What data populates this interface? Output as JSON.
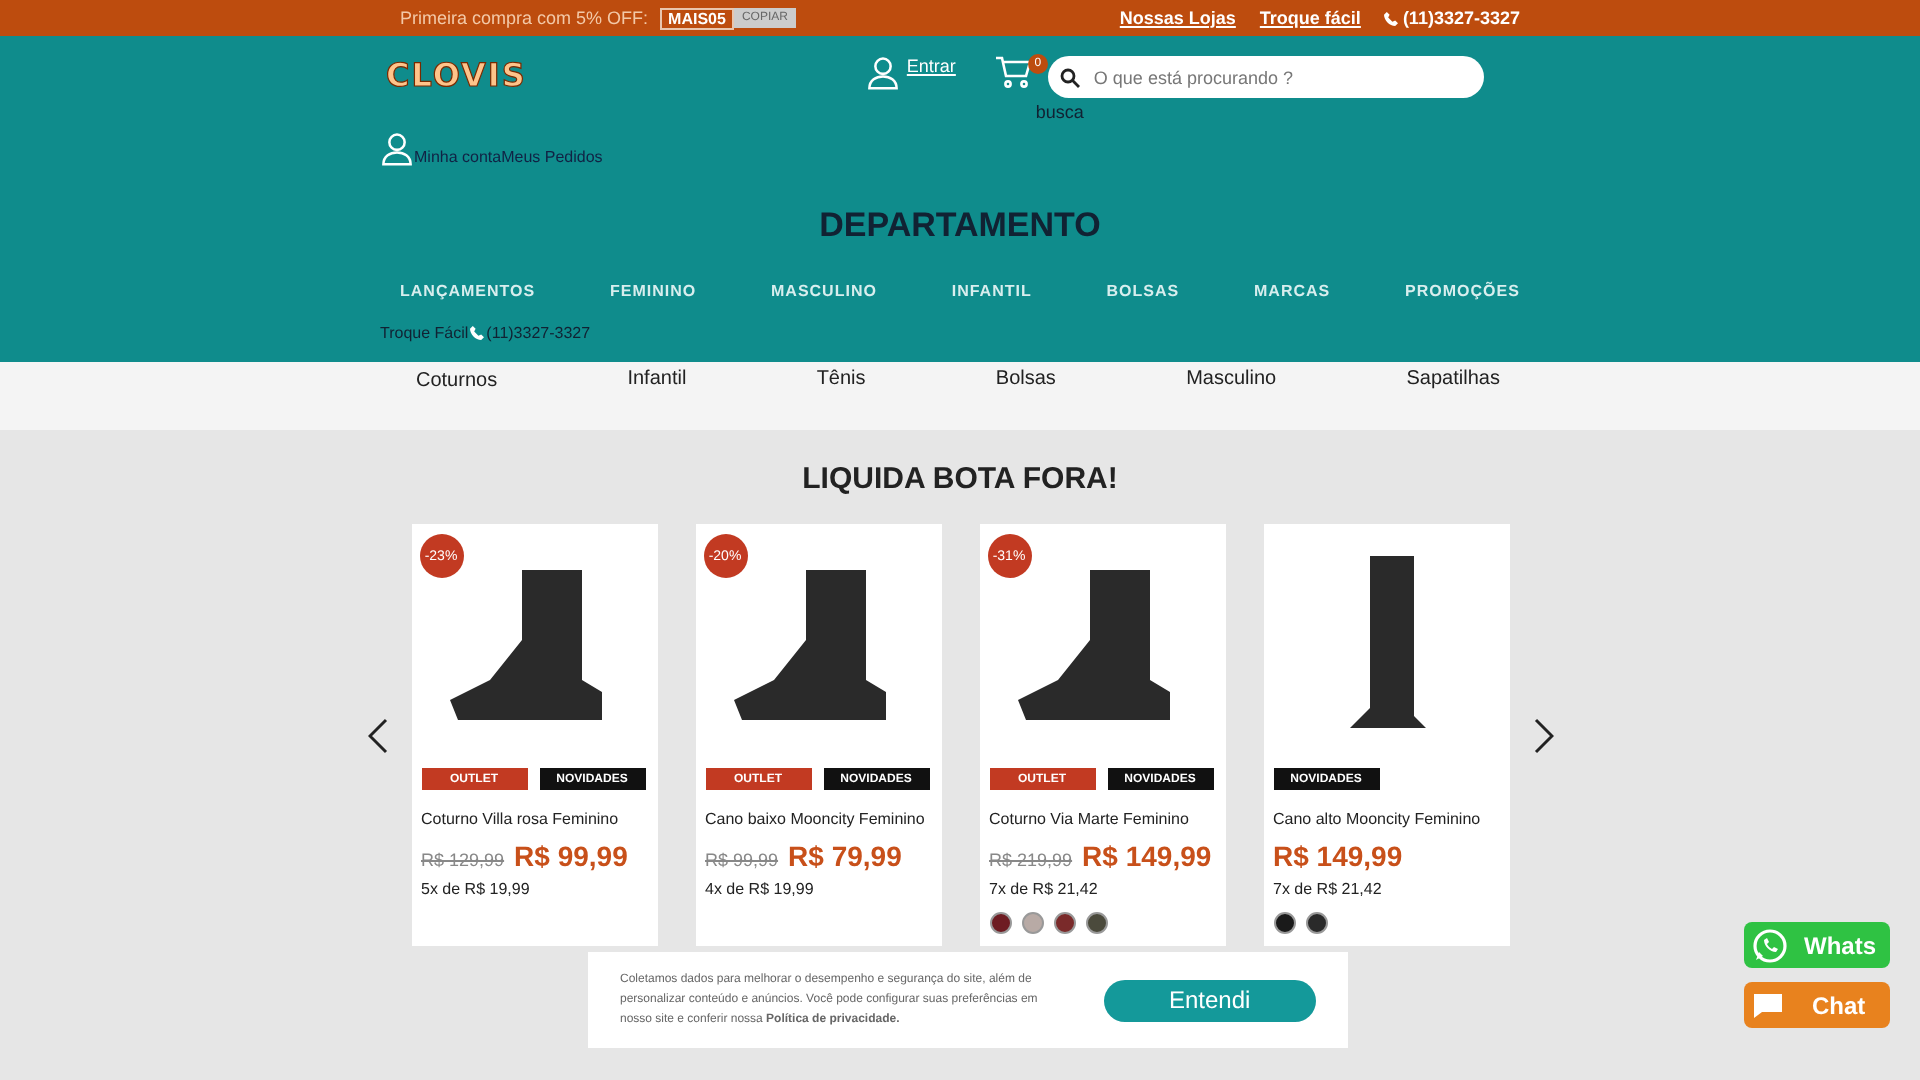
{
  "top_bar": {
    "promo": "Primeira compra com 5% OFF:",
    "coupon_code": "MAIS05",
    "coupon_button": "COPIAR",
    "links": [
      "Nossas Lojas",
      "Troque fácil"
    ],
    "phone": "(11)3327-3327"
  },
  "header": {
    "logo": "CLOVIS",
    "login": "Entrar",
    "cart_count": "0",
    "search_placeholder": "O que está procurando ?",
    "search_caption": "busca",
    "account_links": "Minha contaMeus Pedidos"
  },
  "department": {
    "title": "DEPARTAMENTO",
    "items": [
      "LANÇAMENTOS",
      "FEMININO",
      "MASCULINO",
      "INFANTIL",
      "BOLSAS",
      "MARCAS",
      "PROMOÇÕES"
    ],
    "contact": "Troque Fácil",
    "contact_phone": "(11)3327-3327"
  },
  "categories": [
    "Coturnos",
    "Infantil",
    "Tênis",
    "Bolsas",
    "Masculino",
    "Sapatilhas"
  ],
  "section_title": "LIQUIDA BOTA FORA!",
  "products": [
    {
      "discount": "-23%",
      "tags": [
        {
          "label": "OUTLET",
          "kind": "outlet"
        },
        {
          "label": "NOVIDADES",
          "kind": "new"
        }
      ],
      "name": "Coturno Villa rosa Feminino",
      "old_price": "R$ 129,99",
      "price": "R$ 99,99",
      "installments": "5x de R$ 19,99"
    },
    {
      "discount": "-20%",
      "tags": [
        {
          "label": "OUTLET",
          "kind": "outlet"
        },
        {
          "label": "NOVIDADES",
          "kind": "new"
        }
      ],
      "name": "Cano baixo Mooncity Feminino",
      "old_price": "R$ 99,99",
      "price": "R$ 79,99",
      "installments": "4x de R$ 19,99"
    },
    {
      "discount": "-31%",
      "tags": [
        {
          "label": "OUTLET",
          "kind": "outlet"
        },
        {
          "label": "NOVIDADES",
          "kind": "new"
        }
      ],
      "name": "Coturno Via Marte Feminino",
      "old_price": "R$ 219,99",
      "price": "R$ 149,99",
      "installments": "7x de R$ 21,42",
      "swatches": [
        {
          "color": "#6e1c22"
        },
        {
          "color": "#b8aaa5"
        },
        {
          "color": "#7a2a2a"
        },
        {
          "color": "#4b4a3c"
        }
      ]
    },
    {
      "tags": [
        {
          "label": "NOVIDADES",
          "kind": "new"
        }
      ],
      "name": "Cano alto Mooncity Feminino",
      "price": "R$ 149,99",
      "installments": "7x de R$ 21,42",
      "swatches": [
        {
          "color": "#1a1a1a"
        },
        {
          "color": "#2a2a2a"
        }
      ]
    }
  ],
  "cookie": {
    "text": "Coletamos dados para melhorar o desempenho e segurança do site, além de personalizar conteúdo e anúncios. Você pode configurar suas preferências em nosso site e conferir nossa **Política de privacidade.**",
    "button": "Entendi"
  },
  "floating": {
    "whatsapp": "Whats",
    "chat": "Chat"
  }
}
